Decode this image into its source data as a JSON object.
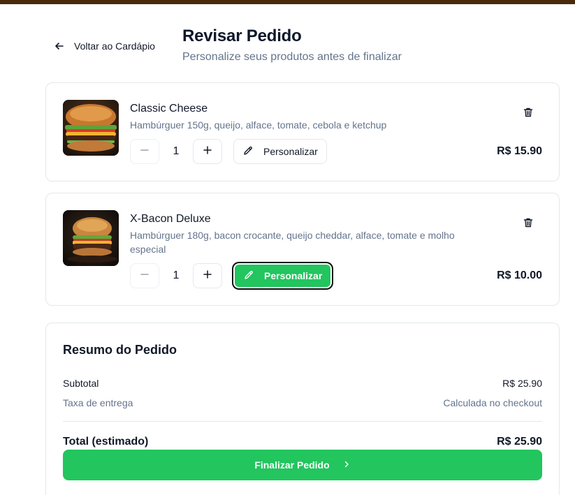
{
  "header": {
    "back_label": "Voltar ao Cardápio",
    "title": "Revisar Pedido",
    "subtitle": "Personalize seus produtos antes de finalizar"
  },
  "items": [
    {
      "name": "Classic Cheese",
      "description": "Hambúrguer 150g, queijo, alface, tomate, cebola e ketchup",
      "quantity": "1",
      "customize_label": "Personalizar",
      "price": "R$ 15.90",
      "customize_active": false
    },
    {
      "name": "X-Bacon Deluxe",
      "description": "Hambúrguer 180g, bacon crocante, queijo cheddar, alface, tomate e molho especial",
      "quantity": "1",
      "customize_label": "Personalizar",
      "price": "R$ 10.00",
      "customize_active": true
    }
  ],
  "summary": {
    "title": "Resumo do Pedido",
    "subtotal_label": "Subtotal",
    "subtotal_value": "R$ 25.90",
    "fee_label": "Taxa de entrega",
    "fee_value": "Calculada no checkout",
    "total_label": "Total (estimado)",
    "total_value": "R$ 25.90",
    "checkout_label": "Finalizar Pedido"
  },
  "colors": {
    "accent": "#22c55e",
    "top_bar": "#4a2a0c",
    "muted_text": "#64748b"
  },
  "icons": [
    "arrow-left-icon",
    "trash-icon",
    "minus-icon",
    "plus-icon",
    "pencil-icon",
    "chevron-right-icon"
  ]
}
